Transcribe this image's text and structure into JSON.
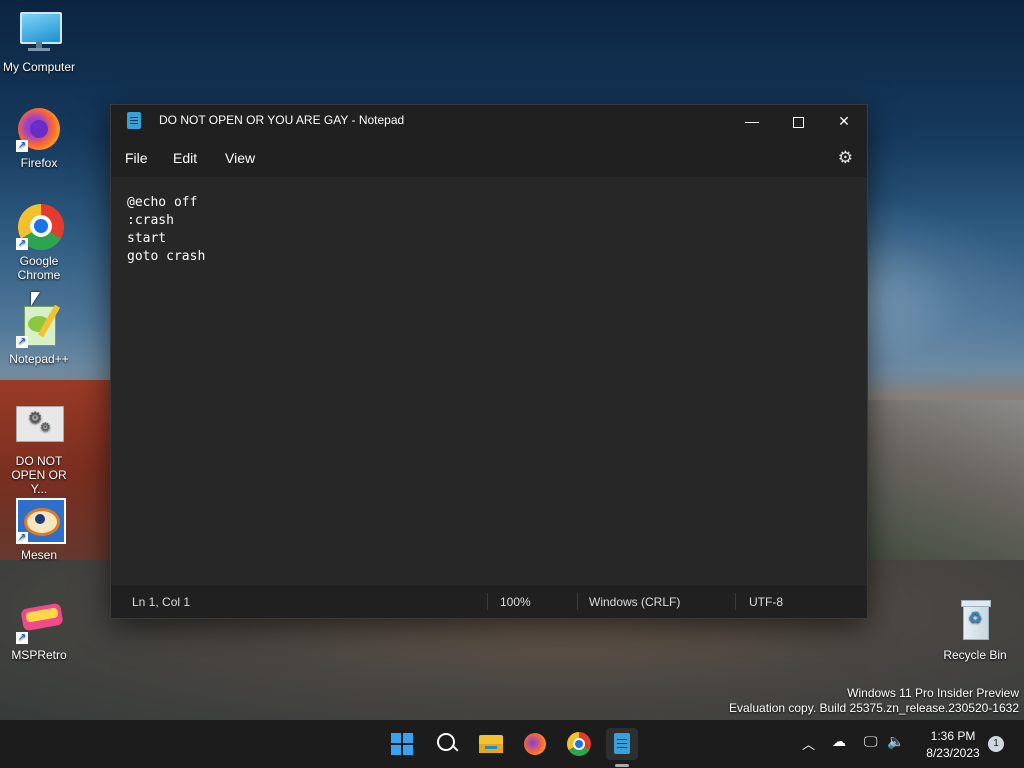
{
  "desktop": {
    "icons": [
      {
        "label": "My Computer",
        "icon": "monitor-icon"
      },
      {
        "label": "Firefox",
        "icon": "firefox-icon"
      },
      {
        "label": "Google Chrome",
        "icon": "chrome-icon"
      },
      {
        "label": "Notepad++",
        "icon": "notepadpp-icon"
      },
      {
        "label": "DO NOT OPEN OR Y...",
        "icon": "batch-file-icon"
      },
      {
        "label": "Mesen",
        "icon": "mesen-icon"
      },
      {
        "label": "MSPRetro",
        "icon": "mspretro-icon"
      },
      {
        "label": "Recycle Bin",
        "icon": "recycle-bin-icon"
      }
    ],
    "watermark_line1": "Windows 11 Pro Insider Preview",
    "watermark_line2": "Evaluation copy. Build 25375.zn_release.230520-1632"
  },
  "notepad": {
    "title": "DO NOT OPEN OR YOU ARE GAY - Notepad",
    "menu": [
      "File",
      "Edit",
      "View"
    ],
    "lines": [
      "@echo off",
      ":crash",
      "start",
      "goto crash"
    ],
    "status": {
      "position": "Ln 1, Col 1",
      "zoom": "100%",
      "line_ending": "Windows (CRLF)",
      "encoding": "UTF-8"
    }
  },
  "taskbar": {
    "time": "1:36 PM",
    "date": "8/23/2023",
    "notification_count": "1",
    "apps": [
      "start-icon",
      "search-icon",
      "file-explorer-icon",
      "firefox-icon",
      "chrome-icon",
      "notepad-icon"
    ]
  },
  "colors": {
    "window_bg": "#272727",
    "titlebar_bg": "#202020",
    "taskbar_bg": "#1c1c1c",
    "accent": "#3aa0d8"
  }
}
